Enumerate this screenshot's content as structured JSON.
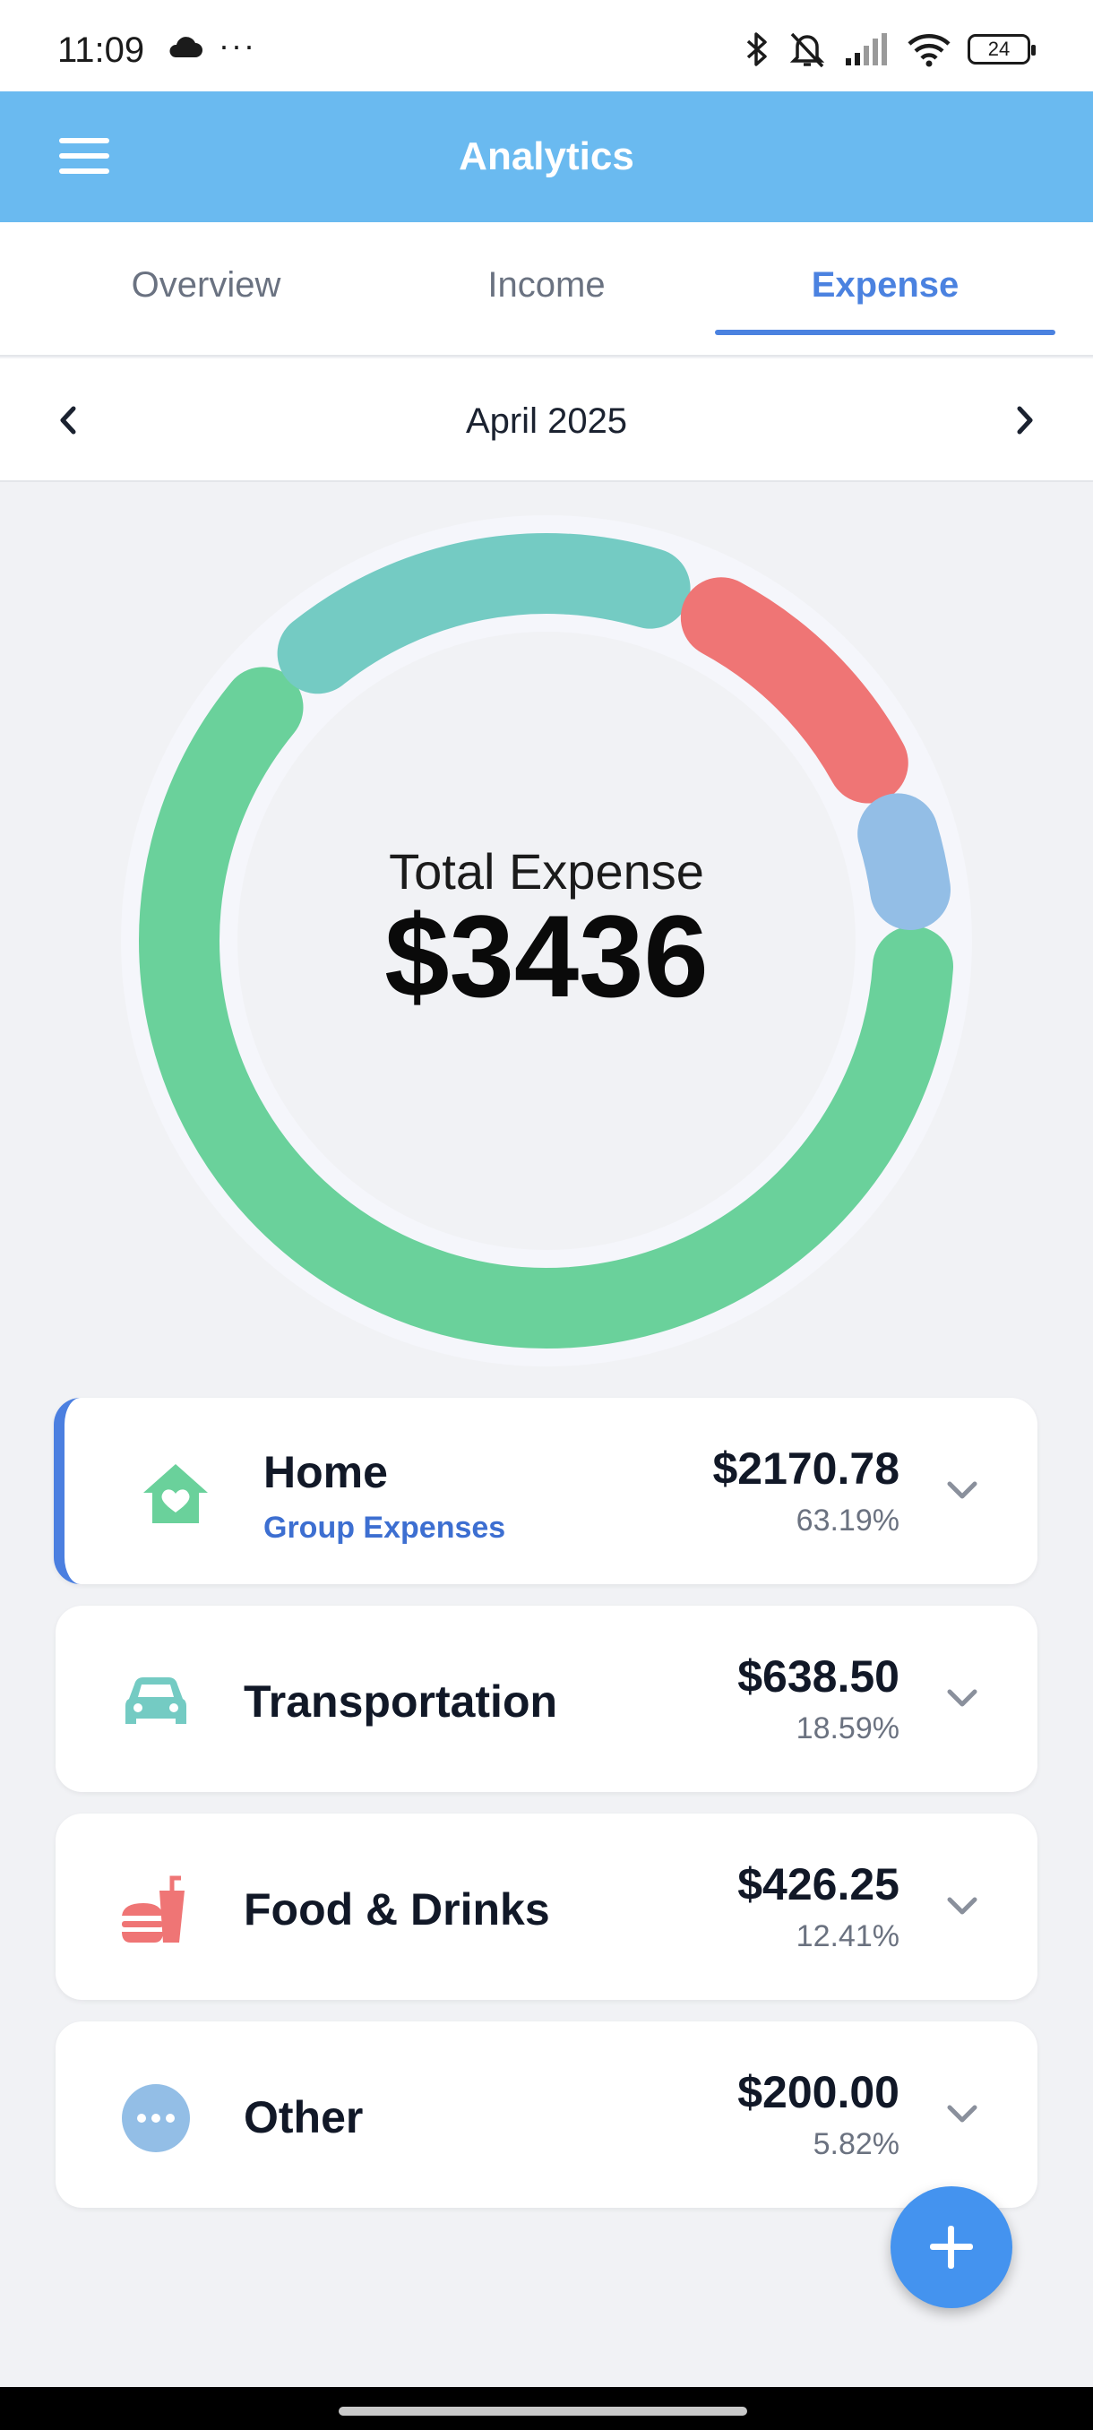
{
  "status_bar": {
    "time": "11:09",
    "dots": "···",
    "battery": "24"
  },
  "app_bar": {
    "title": "Analytics"
  },
  "tabs": [
    {
      "label": "Overview",
      "active": false
    },
    {
      "label": "Income",
      "active": false
    },
    {
      "label": "Expense",
      "active": true
    }
  ],
  "period": {
    "label": "April 2025"
  },
  "summary": {
    "label": "Total Expense",
    "total": "$3436"
  },
  "chart_data": {
    "type": "pie",
    "title": "",
    "categories": [
      "Home",
      "Transportation",
      "Food & Drinks",
      "Other"
    ],
    "values": [
      2170.78,
      638.5,
      426.25,
      200.0
    ],
    "colors": [
      "#6ad19b",
      "#74cbc3",
      "#ef7575",
      "#93bee6"
    ]
  },
  "categories": [
    {
      "name": "Home",
      "subtitle": "Group Expenses",
      "amount": "$2170.78",
      "percent": "63.19%",
      "icon": "home-heart-icon",
      "color": "#6ad19b",
      "selected": true
    },
    {
      "name": "Transportation",
      "amount": "$638.50",
      "percent": "18.59%",
      "icon": "car-icon",
      "color": "#74cbc3",
      "selected": false
    },
    {
      "name": "Food & Drinks",
      "amount": "$426.25",
      "percent": "12.41%",
      "icon": "food-drinks-icon",
      "color": "#ef7575",
      "selected": false
    },
    {
      "name": "Other",
      "amount": "$200.00",
      "percent": "5.82%",
      "icon": "more-dots-icon",
      "color": "#93bee6",
      "selected": false
    }
  ]
}
